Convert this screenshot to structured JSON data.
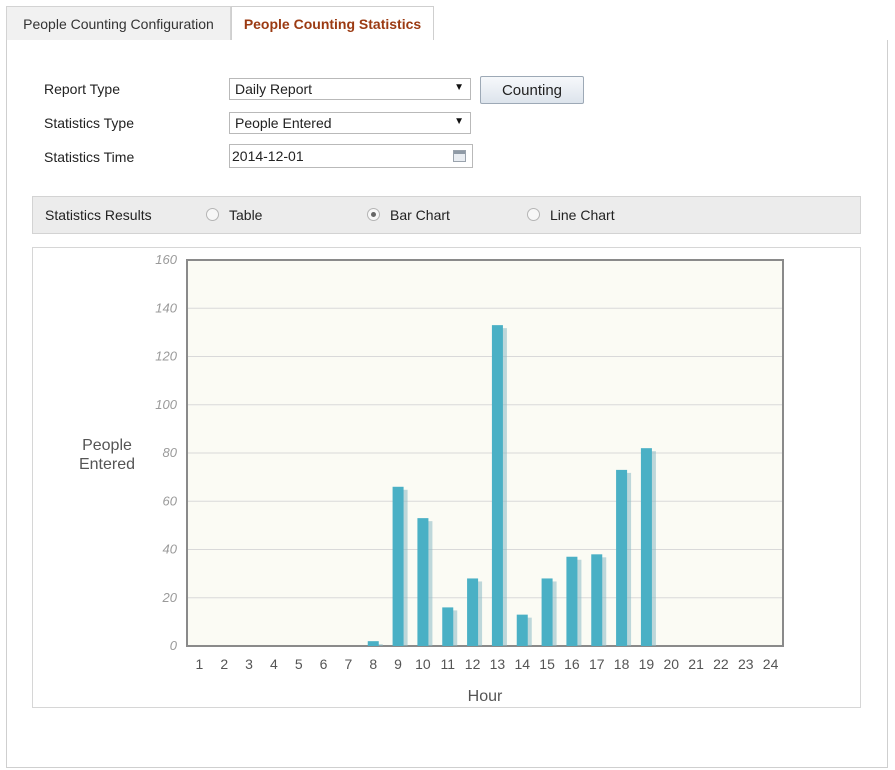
{
  "tabs": [
    {
      "label": "People Counting Configuration",
      "active": false
    },
    {
      "label": "People Counting Statistics",
      "active": true
    }
  ],
  "form": {
    "report_type_label": "Report Type",
    "report_type_value": "Daily Report",
    "statistics_type_label": "Statistics Type",
    "statistics_type_value": "People Entered",
    "statistics_time_label": "Statistics Time",
    "statistics_time_value": "2014-12-01",
    "counting_button": "Counting"
  },
  "results": {
    "label": "Statistics Results",
    "options": [
      {
        "label": "Table",
        "selected": false
      },
      {
        "label": "Bar Chart",
        "selected": true
      },
      {
        "label": "Line Chart",
        "selected": false
      }
    ]
  },
  "icons": {
    "select_arrow": "dropdown-arrow-icon",
    "calendar": "calendar-icon"
  },
  "colors": {
    "active_tab_text": "#9b3a12",
    "bar": "#4ab0c5",
    "bar_shadow": "#8ab9c4",
    "plot_background": "#fbfbf4"
  },
  "chart_data": {
    "type": "bar",
    "ylabel": "People\nEntered",
    "xlabel": "Hour",
    "ylim": [
      0,
      160
    ],
    "yticks": [
      0,
      20,
      40,
      60,
      80,
      100,
      120,
      140,
      160
    ],
    "ytick_labels": [
      "0",
      "20",
      "40",
      "60",
      "80",
      "100",
      "120",
      "140",
      "160"
    ],
    "grid": true,
    "categories": [
      "1",
      "2",
      "3",
      "4",
      "5",
      "6",
      "7",
      "8",
      "9",
      "10",
      "11",
      "12",
      "13",
      "14",
      "15",
      "16",
      "17",
      "18",
      "19",
      "20",
      "21",
      "22",
      "23",
      "24"
    ],
    "values": [
      0,
      0,
      0,
      0,
      0,
      0,
      0,
      2,
      66,
      53,
      16,
      28,
      133,
      13,
      28,
      37,
      38,
      73,
      82,
      0,
      0,
      0,
      0,
      0
    ]
  }
}
